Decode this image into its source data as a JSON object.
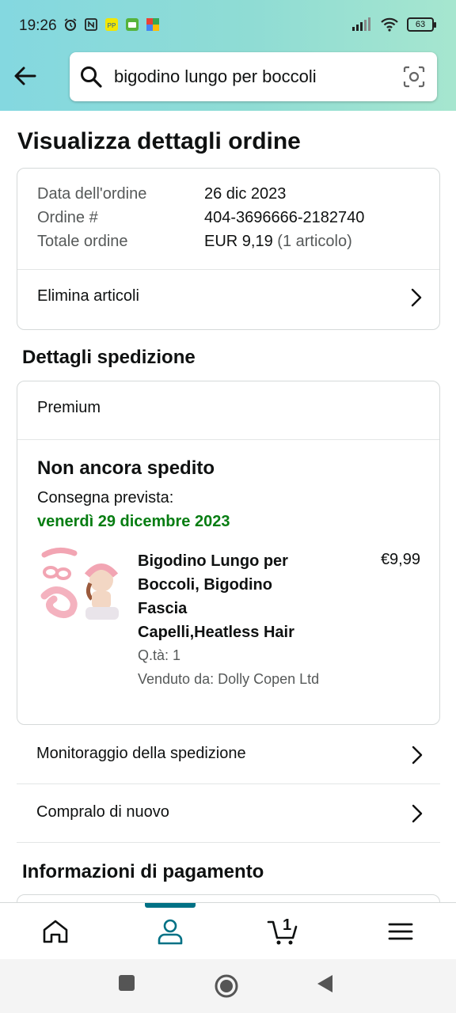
{
  "status_bar": {
    "time": "19:26",
    "battery": "63",
    "icons": [
      "alarm-icon",
      "nfc-icon",
      "app-pp-icon",
      "app-green-icon",
      "app-colorful-icon",
      "signal-icon",
      "wifi-icon",
      "battery-icon"
    ]
  },
  "search": {
    "query": "bigodino lungo per boccoli",
    "icons": [
      "search-icon",
      "camera-scan-icon"
    ]
  },
  "page": {
    "title": "Visualizza dettagli ordine"
  },
  "order": {
    "date_label": "Data dell'ordine",
    "date_value": "26 dic 2023",
    "number_label": "Ordine #",
    "number_value": "404-3696666-2182740",
    "total_label": "Totale ordine",
    "total_value": "EUR 9,19",
    "total_items": "(1 articolo)",
    "delete_items": "Elimina articoli"
  },
  "shipping": {
    "heading": "Dettagli spedizione",
    "method": "Premium",
    "status": "Non ancora spedito",
    "expected_label": "Consegna prevista:",
    "expected_date": "venerdì 29 dicembre 2023",
    "item": {
      "title_lines": [
        "Bigodino Lungo per",
        "Boccoli, Bigodino",
        "Fascia",
        "Capelli,Heatless Hair"
      ],
      "price": "€9,99",
      "qty": "Q.tà: 1",
      "seller": "Venduto da: Dolly Copen Ltd"
    },
    "track": "Monitoraggio della spedizione",
    "buy_again": "Compralo di nuovo"
  },
  "payment": {
    "heading": "Informazioni di pagamento"
  },
  "bottom_nav": {
    "cart_count": "1",
    "items": [
      "home-icon",
      "account-icon",
      "cart-icon",
      "menu-icon"
    ],
    "active": "account-icon"
  },
  "colors": {
    "header_gradient_start": "#84d8e0",
    "header_gradient_end": "#a6e6cf",
    "delivery_green": "#067d12",
    "active_teal": "#007185"
  }
}
